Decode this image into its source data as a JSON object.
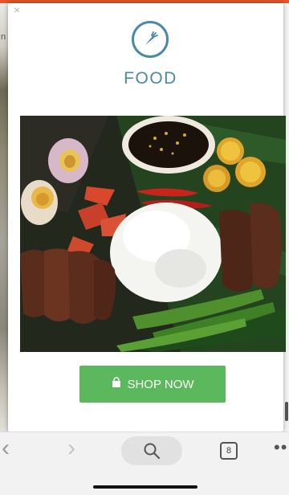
{
  "ad": {
    "brand": "FOOD",
    "logo_icon": "carrot-icon",
    "close_icon": "close-icon",
    "photo": "plate of rice, grilled sausage, salted egg, tomato, calamansi and dipping sauce on banana leaf",
    "cta": {
      "label": "SHOP NOW",
      "icon": "shopping-bag-icon",
      "color": "#5cb85c"
    },
    "accent_color": "#4a89a8"
  },
  "browser": {
    "tab_count": "8",
    "back_icon": "chevron-left-icon",
    "forward_icon": "chevron-right-icon",
    "search_icon": "search-icon",
    "more_icon": "more-icon"
  }
}
